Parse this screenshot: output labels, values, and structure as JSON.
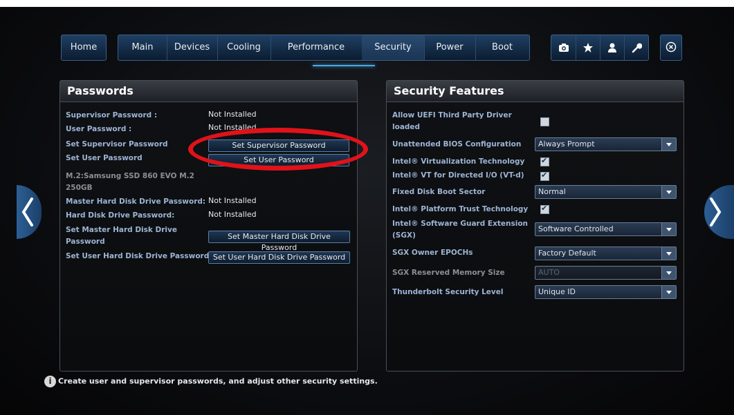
{
  "nav": {
    "home": "Home",
    "main": "Main",
    "devices": "Devices",
    "cooling": "Cooling",
    "performance": "Performance",
    "security": "Security",
    "power": "Power",
    "boot": "Boot",
    "icons": [
      "camera-icon",
      "star-icon",
      "user-icon",
      "wrench-icon"
    ],
    "exit_icon": "close-circle-icon",
    "active_tab": "Security",
    "accent_color": "#4aa7e8"
  },
  "passwords": {
    "title": "Passwords",
    "supervisor_password_label": "Supervisor Password :",
    "supervisor_password_value": "Not Installed",
    "user_password_label": "User Password :",
    "user_password_value": "Not Installed",
    "set_supervisor_label": "Set Supervisor Password",
    "set_supervisor_button": "Set Supervisor Password",
    "set_user_label": "Set User Password",
    "set_user_button": "Set User Password",
    "drive_label": "M.2:Samsung SSD 860 EVO M.2 250GB",
    "master_hdd_label": "Master Hard Disk Drive Password:",
    "master_hdd_value": "Not Installed",
    "hdd_label": "Hard Disk Drive Password:",
    "hdd_value": "Not Installed",
    "set_master_hdd_label": "Set Master Hard Disk Drive Password",
    "set_master_hdd_button": "Set Master Hard Disk Drive Password",
    "set_user_hdd_label": "Set User Hard Disk Drive Password",
    "set_user_hdd_button": "Set User Hard Disk Drive Password"
  },
  "security": {
    "title": "Security Features",
    "uefi_label": "Allow UEFI Third Party Driver loaded",
    "uefi_checked": false,
    "unattended_label": "Unattended BIOS Configuration",
    "unattended_value": "Always Prompt",
    "vt_label": "Intel® Virtualization Technology",
    "vt_checked": true,
    "vtd_label": "Intel® VT for Directed I/O (VT-d)",
    "vtd_checked": true,
    "fixed_disk_label": "Fixed Disk Boot Sector",
    "fixed_disk_value": "Normal",
    "ptt_label": "Intel® Platform Trust Technology",
    "ptt_checked": true,
    "sgx_label": "Intel® Software Guard Extension (SGX)",
    "sgx_value": "Software Controlled",
    "sgx_epoch_label": "SGX Owner EPOCHs",
    "sgx_epoch_value": "Factory Default",
    "sgx_mem_label": "SGX Reserved Memory Size",
    "sgx_mem_value": "AUTO",
    "tb_label": "Thunderbolt Security Level",
    "tb_value": "Unique ID"
  },
  "info": {
    "icon": "info-icon",
    "text": "Create user and supervisor passwords, and adjust other security settings."
  },
  "side_nav": {
    "left_icon": "chevron-left-icon",
    "right_icon": "chevron-right-icon"
  }
}
